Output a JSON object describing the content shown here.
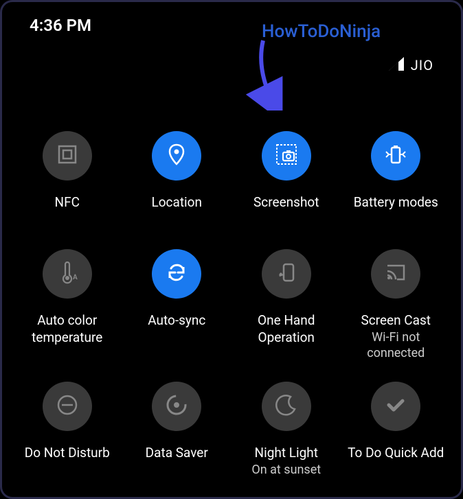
{
  "status": {
    "time": "4:36 PM",
    "carrier": "JIO"
  },
  "overlay": {
    "watermark": "HowToDoNinja"
  },
  "tiles": [
    {
      "label": "NFC",
      "sublabel": "",
      "active": false
    },
    {
      "label": "Location",
      "sublabel": "",
      "active": true
    },
    {
      "label": "Screenshot",
      "sublabel": "",
      "active": true
    },
    {
      "label": "Battery modes",
      "sublabel": "",
      "active": true
    },
    {
      "label": "Auto color temperature",
      "sublabel": "",
      "active": false
    },
    {
      "label": "Auto-sync",
      "sublabel": "",
      "active": true
    },
    {
      "label": "One Hand Operation",
      "sublabel": "",
      "active": false
    },
    {
      "label": "Screen Cast",
      "sublabel": "Wi-Fi not connected",
      "active": false
    },
    {
      "label": "Do Not Disturb",
      "sublabel": "",
      "active": false
    },
    {
      "label": "Data Saver",
      "sublabel": "",
      "active": false
    },
    {
      "label": "Night Light",
      "sublabel": "On at sunset",
      "active": false
    },
    {
      "label": "To Do Quick Add",
      "sublabel": "",
      "active": false
    }
  ]
}
